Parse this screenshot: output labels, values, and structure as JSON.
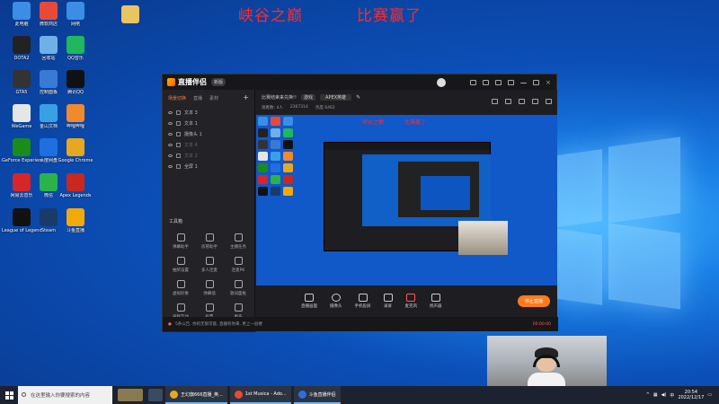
{
  "overlay": {
    "left_text": "峡谷之巅",
    "right_text": "比赛赢了"
  },
  "desktop_icons": [
    {
      "label": "此电脑",
      "color": "#3a8ee6"
    },
    {
      "label": "微软商店",
      "color": "#e84a3a"
    },
    {
      "label": "网络",
      "color": "#3a8ee6"
    },
    {
      "label": "DOTA2",
      "color": "#222"
    },
    {
      "label": "回收站",
      "color": "#6fb0e6"
    },
    {
      "label": "QQ音乐",
      "color": "#1fb85a"
    },
    {
      "label": "GTA5",
      "color": "#333"
    },
    {
      "label": "控制面板",
      "color": "#3a7ad6"
    },
    {
      "label": "腾讯QQ",
      "color": "#111"
    },
    {
      "label": "WeGame",
      "color": "#e6e6e6"
    },
    {
      "label": "金山文档",
      "color": "#3aa0e6"
    },
    {
      "label": "哔哩哔哩",
      "color": "#f08a2a"
    },
    {
      "label": "GeForce Experience",
      "color": "#1a8c1a"
    },
    {
      "label": "百度网盘",
      "color": "#1f6fe0"
    },
    {
      "label": "Google Chrome",
      "color": "#e6a820"
    },
    {
      "label": "网易云音乐",
      "color": "#d8252a"
    },
    {
      "label": "微信",
      "color": "#2ab34a"
    },
    {
      "label": "Apex Legends",
      "color": "#c8281e"
    },
    {
      "label": "League of Legends",
      "color": "#111"
    },
    {
      "label": "Steam",
      "color": "#1a3a6a"
    },
    {
      "label": "斗鱼直播",
      "color": "#f2a90a"
    }
  ],
  "app": {
    "title": "直播伴侣",
    "version": "新版",
    "left_tabs": [
      "场景切换",
      "直播",
      "素材"
    ],
    "scenes": [
      "文本 3",
      "文本 1",
      "摄像头 1",
      "文本 4",
      "文本 2",
      "全屏 1"
    ],
    "tools_title": "工具箱",
    "tools": [
      "弹幕助手",
      "房管助手",
      "主播任务",
      "抽奖设置",
      "多人连麦",
      "连麦PK",
      "虚拟形象",
      "弹幕墙",
      "歌词面板",
      "视频互动",
      "投票",
      "更多"
    ],
    "stream_title": "比赛结束来兑换!!",
    "category": "游戏",
    "game": "APEX英雄",
    "tags": [
      "观看数: 4人",
      "2367314",
      "热度 6462"
    ],
    "preview_overlay_left": "峡谷之巅",
    "preview_overlay_right": "比赛赢了",
    "bottom_tools": [
      "直播画面",
      "摄像头",
      "手机投屏",
      "录屏",
      "麦克风",
      "扬声器"
    ],
    "start_button": "停止直播",
    "status_text": "5条公告, 你的无限可能, 直播有你来, 更上一层楼",
    "status_time": "00:00:00"
  },
  "taskbar": {
    "search_placeholder": "在这里输入你要搜索的内容",
    "apps": [
      {
        "label": "王幻旗666直播_英...",
        "color": "#e6a820"
      },
      {
        "label": "1st Musica - Ado...",
        "color": "#e84a3a"
      },
      {
        "label": "斗鱼直播伴侣",
        "color": "#2a6fe0"
      }
    ],
    "time": "20:54",
    "date": "2022/12/17"
  }
}
